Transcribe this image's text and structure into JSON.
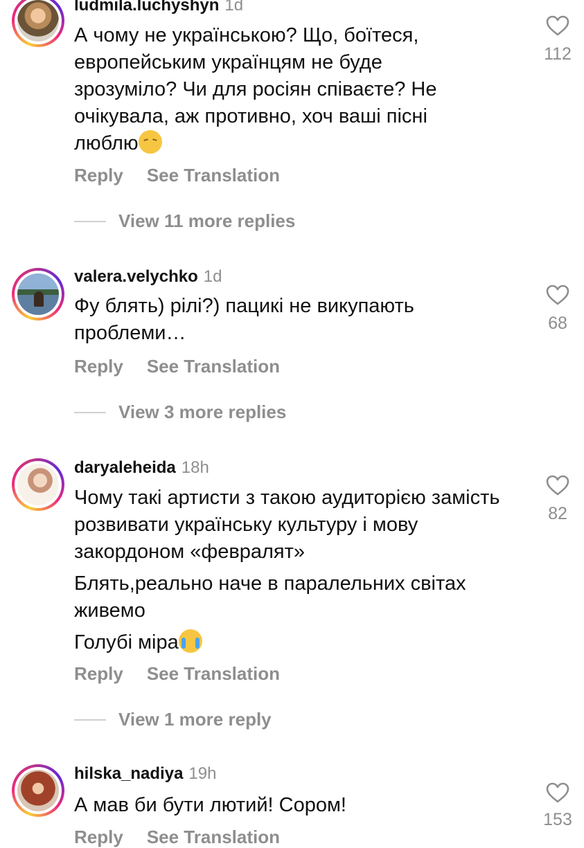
{
  "comments": [
    {
      "username": "ludmila.luchyshyn",
      "time": "1d",
      "lines": [
        "А чому не українською? Що, боїтеся,",
        "европейським українцям не буде",
        "зрозуміло? Чи для росіян співаєте? Не",
        "очікувала, аж противно, хоч ваші пісні",
        "люблю"
      ],
      "emoji": "sad-face-emoji",
      "likes": "112",
      "reply_label": "Reply",
      "translate_label": "See Translation",
      "more_replies": "View 11 more replies"
    },
    {
      "username": "valera.velychko",
      "time": "1d",
      "lines": [
        "Фу блять) рілі?) пацикі не викупають",
        "проблеми…"
      ],
      "likes": "68",
      "reply_label": "Reply",
      "translate_label": "See Translation",
      "more_replies": "View 3 more replies"
    },
    {
      "username": "daryaleheida",
      "time": "18h",
      "paragraphs": [
        "Чому такі артисти з такою аудиторією замість розвивати українську культуру і мову закордоном «февралят»",
        "Блять,реально наче в паралельних світах живемо",
        "Голубі міра"
      ],
      "emoji": "crying-face-emoji",
      "likes": "82",
      "reply_label": "Reply",
      "translate_label": "See Translation",
      "more_replies": "View 1 more reply"
    },
    {
      "username": "hilska_nadiya",
      "time": "19h",
      "lines": [
        "А мав би бути лютий!  Сором!"
      ],
      "likes": "153",
      "reply_label": "Reply",
      "translate_label": "See Translation"
    }
  ],
  "colors": {
    "secondary_text": "#8e8e8e",
    "primary_text": "#111111",
    "story_ring": "#ee2a7b"
  },
  "icons": {
    "like": "heart-outline-icon"
  }
}
